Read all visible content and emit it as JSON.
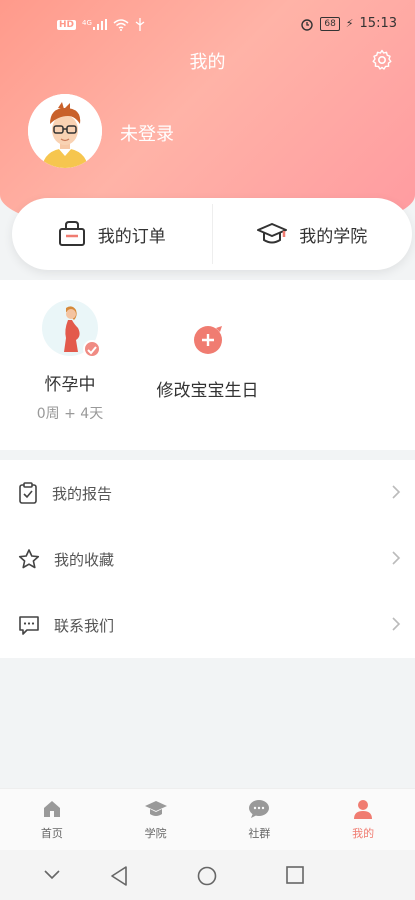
{
  "status_bar": {
    "left_icons": [
      "hd-icon",
      "signal-4g-icon",
      "wifi-icon",
      "usb-icon"
    ],
    "hd_text": "HD",
    "network_text": "4G",
    "alarm_icon": "alarm-icon",
    "battery": "68",
    "time": "15:13"
  },
  "header": {
    "title": "我的",
    "settings_icon": "gear-icon",
    "login_text": "未登录"
  },
  "quick_card": {
    "orders_label": "我的订单",
    "academy_label": "我的学院"
  },
  "pregnancy": {
    "status_label": "怀孕中",
    "weeks_days": "0周 + 4天",
    "edit_label": "修改宝宝生日"
  },
  "menu": {
    "items": [
      {
        "label": "我的报告",
        "icon": "report-icon"
      },
      {
        "label": "我的收藏",
        "icon": "star-icon"
      },
      {
        "label": "联系我们",
        "icon": "message-icon"
      }
    ]
  },
  "tabbar": {
    "tabs": [
      {
        "label": "首页",
        "icon": "home-icon"
      },
      {
        "label": "学院",
        "icon": "graduation-cap-icon"
      },
      {
        "label": "社群",
        "icon": "chat-bubble-icon"
      },
      {
        "label": "我的",
        "icon": "user-icon"
      }
    ],
    "active_color": "#f07c71"
  },
  "colors": {
    "header_gradient_start": "#ff9a8b",
    "header_gradient_end": "#ff9aa0",
    "accent": "#f07c71"
  }
}
